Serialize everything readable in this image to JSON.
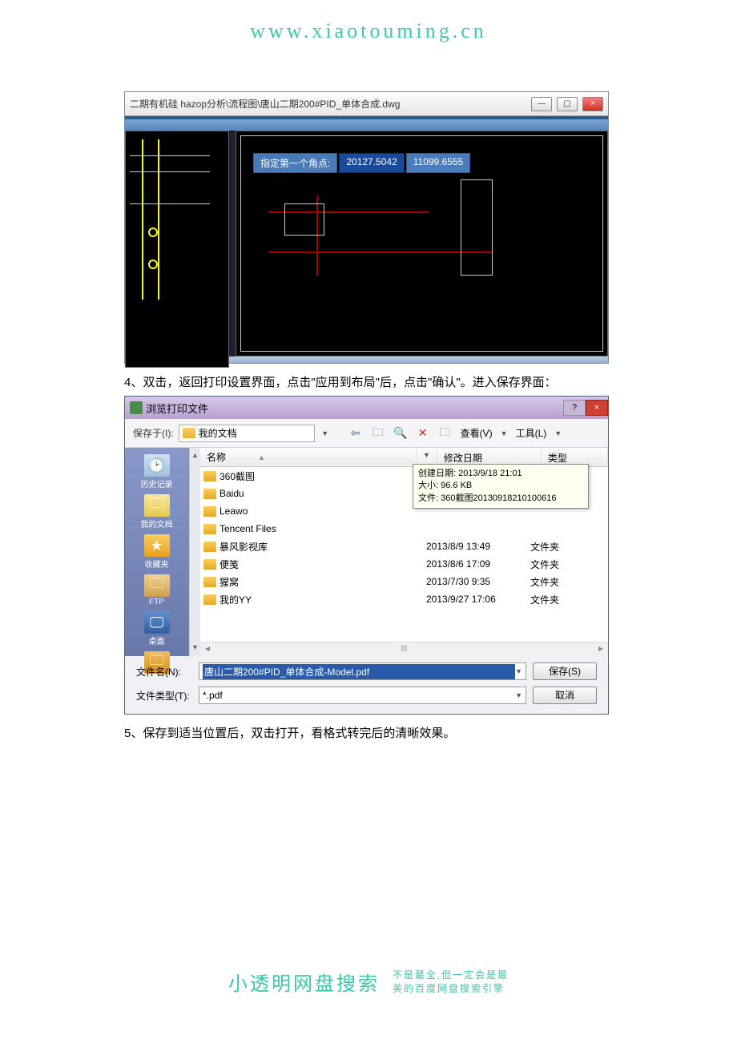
{
  "watermark": {
    "top_url": "www.xiaotouming.cn",
    "bottom_title": "小透明网盘搜索",
    "bottom_line1": "不是最全,但一定会是最",
    "bottom_line2": "美的百度网盘搜索引擎"
  },
  "cad": {
    "title_text": "二期有机硅 hazop分析\\流程图\\唐山二期200#PID_单体合成.dwg",
    "tooltip_label": "指定第一个角点:",
    "tooltip_val1": "20127.5042",
    "tooltip_val2": "11099.6555"
  },
  "step4": "4、双击，返回打印设置界面，点击\"应用到布局\"后，点击\"确认\"。进入保存界面：",
  "step5": "5、保存到适当位置后，双击打开，看格式转完后的清晰效果。",
  "dialog": {
    "title": "浏览打印文件",
    "help_icon": "?",
    "close_icon": "×",
    "save_in_label": "保存于(I):",
    "save_in_value": "我的文档",
    "view_label": "查看(V)",
    "tools_label": "工具(L)",
    "columns": {
      "name": "名称",
      "date": "修改日期",
      "type": "类型"
    },
    "sidebar": [
      {
        "label": "历史记录"
      },
      {
        "label": "我的文档"
      },
      {
        "label": "收藏夹"
      },
      {
        "label": "FTP"
      },
      {
        "label": "桌面"
      },
      {
        "label": ""
      }
    ],
    "files": [
      {
        "name": "360截图",
        "date": "2013/9/18 21:01",
        "type": "文件夹"
      },
      {
        "name": "Baidu",
        "date": "",
        "type": ""
      },
      {
        "name": "Leawo",
        "date": "",
        "type": ""
      },
      {
        "name": "Tencent Files",
        "date": "",
        "type": ""
      },
      {
        "name": "暴风影视库",
        "date": "2013/8/9 13:49",
        "type": "文件夹"
      },
      {
        "name": "便笺",
        "date": "2013/8/6 17:09",
        "type": "文件夹"
      },
      {
        "name": "猩窝",
        "date": "2013/7/30 9:35",
        "type": "文件夹"
      },
      {
        "name": "我的YY",
        "date": "2013/9/27 17:06",
        "type": "文件夹"
      }
    ],
    "tooltip": {
      "line1": "创建日期: 2013/9/18 21:01",
      "line2": "大小: 96.6 KB",
      "line3": "文件: 360截图20130918210100616"
    },
    "filename_label": "文件名(N):",
    "filename_value": "唐山二期200#PID_单体合成-Model.pdf",
    "filetype_label": "文件类型(T):",
    "filetype_value": "*.pdf",
    "save_btn": "保存(S)",
    "cancel_btn": "取消"
  }
}
